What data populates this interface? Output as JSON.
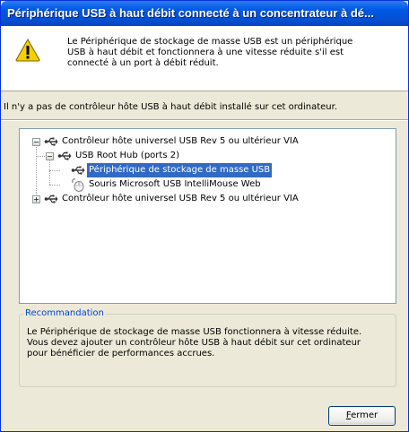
{
  "window": {
    "title": "Périphérique USB à haut débit connecté à un concentrateur à dé..."
  },
  "header": {
    "icon": "warning-icon",
    "message": "Le Périphérique de stockage de masse USB est un périphérique USB à haut débit et fonctionnera à une vitesse réduite s'il est connecté à un port à débit réduit."
  },
  "info": "Il n'y a pas de contrôleur hôte USB à haut débit installé sur cet ordinateur.",
  "tree": {
    "items": [
      {
        "label": "Contrôleur hôte universel USB Rev 5 ou  ultérieur VIA",
        "expander": "−",
        "icon": "usb-controller-icon",
        "level": 0,
        "selected": false
      },
      {
        "label": "USB Root Hub (ports 2)",
        "expander": "−",
        "icon": "usb-hub-icon",
        "level": 1,
        "selected": false
      },
      {
        "label": "Périphérique de stockage de masse USB",
        "expander": "",
        "icon": "usb-device-icon",
        "level": 2,
        "selected": true
      },
      {
        "label": "Souris Microsoft USB IntelliMouse Web",
        "expander": "",
        "icon": "mouse-icon",
        "level": 2,
        "selected": false
      },
      {
        "label": "Contrôleur hôte universel USB Rev 5 ou  ultérieur VIA",
        "expander": "+",
        "icon": "usb-controller-icon",
        "level": 0,
        "selected": false
      }
    ]
  },
  "recommendation": {
    "legend": "Recommandation",
    "text": "Le Périphérique de stockage de masse USB fonctionnera à vitesse réduite. Vous devez ajouter un contrôleur hôte USB à haut débit sur cet ordinateur pour bénéficier de performances accrues."
  },
  "buttons": {
    "close_mnemonic": "F",
    "close_rest": "ermer"
  },
  "colors": {
    "title_bar": "#0058e6",
    "selection": "#316ac5",
    "legend": "#0046d5"
  }
}
